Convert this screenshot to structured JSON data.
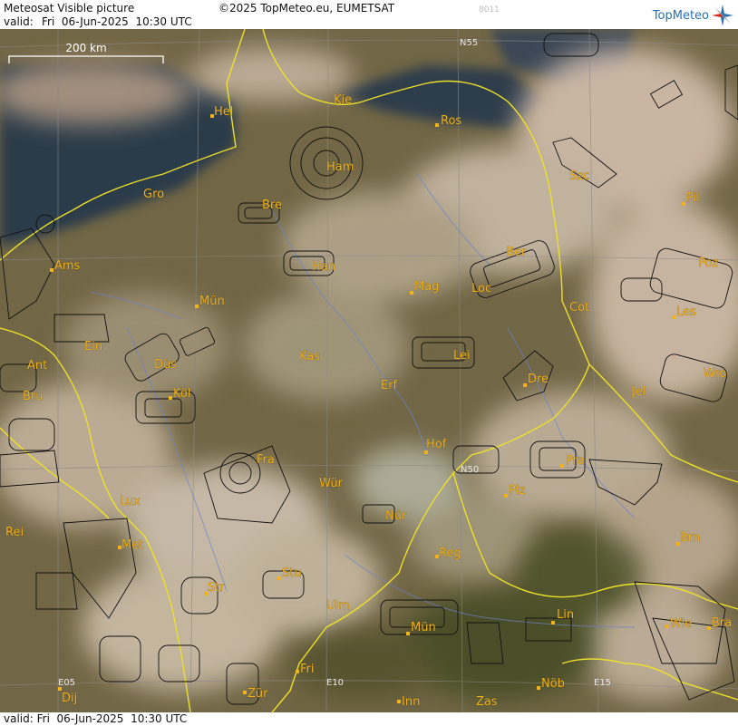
{
  "header": {
    "product": "Meteosat Visible picture",
    "copyright": "©2025 TopMeteo.eu, EUMETSAT",
    "image_code": "8011",
    "valid_label": "valid:",
    "valid_time": "Fri  06-Jun-2025  10:30 UTC",
    "logo_text": "TopMeteo"
  },
  "footer": {
    "valid_label": "valid:",
    "valid_time": "Fri  06-Jun-2025  10:30 UTC"
  },
  "scale": {
    "label": "200 km"
  },
  "grid_labels": {
    "n55": "N55",
    "n50": "N50",
    "e05": "E05",
    "e10": "E10",
    "e15": "E15"
  },
  "cities": [
    {
      "name": "Hel"
    },
    {
      "name": "Kie"
    },
    {
      "name": "Ros"
    },
    {
      "name": "Ham"
    },
    {
      "name": "Szc"
    },
    {
      "name": "Pil"
    },
    {
      "name": "Gro"
    },
    {
      "name": "Bre"
    },
    {
      "name": "Ber"
    },
    {
      "name": "Ams"
    },
    {
      "name": "Han"
    },
    {
      "name": "Mag"
    },
    {
      "name": "Loc"
    },
    {
      "name": "Poz"
    },
    {
      "name": "Mün"
    },
    {
      "name": "Cot"
    },
    {
      "name": "Les"
    },
    {
      "name": "Ein"
    },
    {
      "name": "Kas"
    },
    {
      "name": "Lei"
    },
    {
      "name": "Ant"
    },
    {
      "name": "Düs"
    },
    {
      "name": "Dre"
    },
    {
      "name": "Wro"
    },
    {
      "name": "Bru"
    },
    {
      "name": "Köl"
    },
    {
      "name": "Erf"
    },
    {
      "name": "Jel"
    },
    {
      "name": "Hof"
    },
    {
      "name": "Fra"
    },
    {
      "name": "Pra"
    },
    {
      "name": "N50"
    },
    {
      "name": "Lux"
    },
    {
      "name": "Wür"
    },
    {
      "name": "Plz"
    },
    {
      "name": "Rei"
    },
    {
      "name": "Nür"
    },
    {
      "name": "Met"
    },
    {
      "name": "Brn"
    },
    {
      "name": "Reg"
    },
    {
      "name": "Stu"
    },
    {
      "name": "Str"
    },
    {
      "name": "Ulm"
    },
    {
      "name": "Lin"
    },
    {
      "name": "Mün"
    },
    {
      "name": "Wie"
    },
    {
      "name": "Bra"
    },
    {
      "name": "Fri"
    },
    {
      "name": "Dij"
    },
    {
      "name": "Zür"
    },
    {
      "name": "Inn"
    },
    {
      "name": "Zas"
    },
    {
      "name": "Nöb"
    }
  ]
}
